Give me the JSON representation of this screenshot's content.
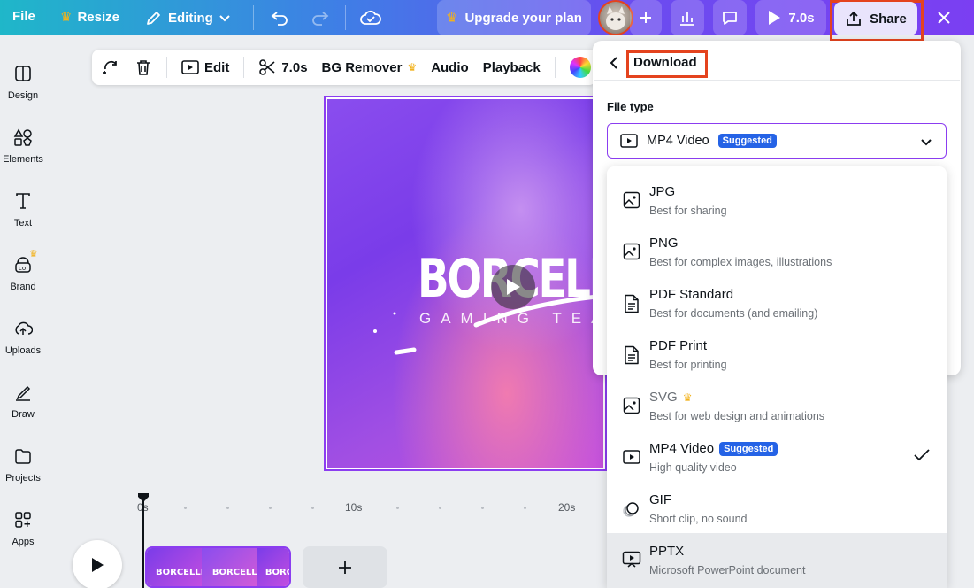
{
  "topbar": {
    "file": "File",
    "resize": "Resize",
    "editing": "Editing",
    "upgrade": "Upgrade your plan",
    "duration": "7.0s",
    "share": "Share"
  },
  "toolbar": {
    "edit": "Edit",
    "duration": "7.0s",
    "bg_remover": "BG Remover",
    "audio": "Audio",
    "playback": "Playback"
  },
  "sidebar": {
    "items": [
      {
        "label": "Design",
        "icon": "design-icon"
      },
      {
        "label": "Elements",
        "icon": "elements-icon"
      },
      {
        "label": "Text",
        "icon": "text-icon"
      },
      {
        "label": "Brand",
        "icon": "brand-icon"
      },
      {
        "label": "Uploads",
        "icon": "uploads-icon"
      },
      {
        "label": "Draw",
        "icon": "draw-icon"
      },
      {
        "label": "Projects",
        "icon": "projects-icon"
      },
      {
        "label": "Apps",
        "icon": "apps-icon"
      }
    ]
  },
  "canvas": {
    "logo_title": "BORCELLE",
    "logo_subtitle": "GAMING TEAM"
  },
  "timeline": {
    "ticks": [
      "0s",
      "10s",
      "20s"
    ],
    "clip_label": "BORCELLE"
  },
  "download_panel": {
    "title": "Download",
    "file_type_label": "File type",
    "selected": "MP4 Video",
    "selected_badge": "Suggested",
    "options": [
      {
        "name": "JPG",
        "desc": "Best for sharing",
        "icon": "image-icon"
      },
      {
        "name": "PNG",
        "desc": "Best for complex images, illustrations",
        "icon": "image-icon"
      },
      {
        "name": "PDF Standard",
        "desc": "Best for documents (and emailing)",
        "icon": "document-icon"
      },
      {
        "name": "PDF Print",
        "desc": "Best for printing",
        "icon": "document-icon"
      },
      {
        "name": "SVG",
        "desc": "Best for web design and animations",
        "icon": "image-icon",
        "premium": true
      },
      {
        "name": "MP4 Video",
        "desc": "High quality video",
        "icon": "video-icon",
        "badge": "Suggested",
        "checked": true
      },
      {
        "name": "GIF",
        "desc": "Short clip, no sound",
        "icon": "gif-icon"
      },
      {
        "name": "PPTX",
        "desc": "Microsoft PowerPoint document",
        "icon": "presentation-icon",
        "hovered": true
      }
    ]
  },
  "colors": {
    "accent": "#8b3df0",
    "highlight_box": "#e4431e",
    "badge": "#2563e6",
    "premium": "#f2b21c"
  }
}
